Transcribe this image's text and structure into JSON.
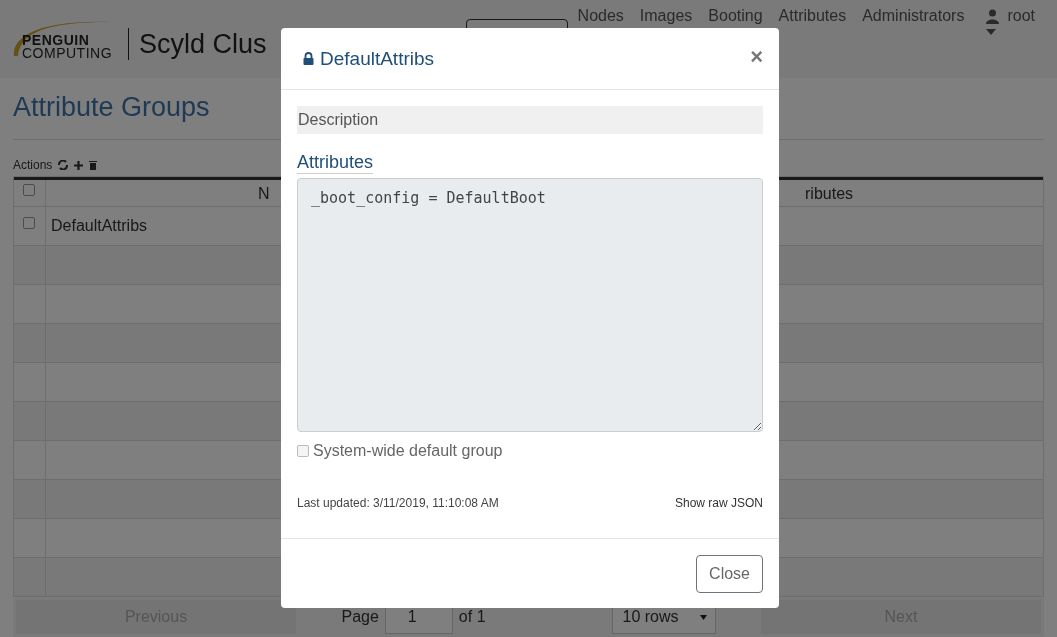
{
  "header": {
    "logo": {
      "line_1": "PENGUIN",
      "line_2": "COMPUTING",
      "product": "Scyld Clus"
    },
    "nav": [
      {
        "label": "Nodes"
      },
      {
        "label": "Images"
      },
      {
        "label": "Booting"
      },
      {
        "label": "Attributes"
      },
      {
        "label": "Administrators"
      }
    ],
    "user": "root"
  },
  "page": {
    "title": "Attribute Groups",
    "actions_label": "Actions",
    "table": {
      "all_selected": false,
      "columns": [
        "N",
        "ributes"
      ],
      "rows": [
        {
          "name": "DefaultAttribs",
          "selected": false
        }
      ]
    },
    "pagination": {
      "previous": "Previous",
      "page_label": "Page",
      "page_value": "1",
      "of_label": "of 1",
      "rows_select": "10 rows",
      "next": "Next"
    }
  },
  "modal": {
    "title": "DefaultAttribs",
    "close_icon": "×",
    "description_placeholder": "Description",
    "attributes_label": "Attributes",
    "attributes_value": "_boot_config = DefaultBoot",
    "system_default": {
      "label": "System-wide default group",
      "checked": false,
      "disabled": true
    },
    "last_updated": "Last updated: 3/11/2019, 11:10:08 AM",
    "raw_json_link": "Show raw JSON",
    "close_button": "Close"
  }
}
